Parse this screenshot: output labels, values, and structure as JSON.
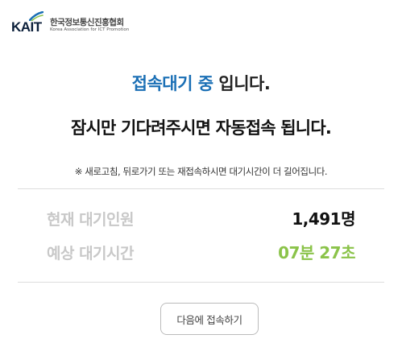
{
  "logo": {
    "mark": "KAIT",
    "name_ko": "한국정보통신진흥협회",
    "name_en": "Korea Association for ICT Promotion"
  },
  "status": {
    "title_highlight": "접속대기 중",
    "title_rest": " 입니다.",
    "message": "잠시만 기다려주시면 자동접속 됩니다.",
    "notice": "※ 새로고침, 뒤로가기 또는 재접속하시면 대기시간이 더 길어집니다."
  },
  "queue": {
    "waiting_label": "현재 대기인원",
    "waiting_value": "1,491명",
    "time_label": "예상 대기시간",
    "time_value": "07분 27초"
  },
  "actions": {
    "next_label": "다음에 접속하기"
  },
  "colors": {
    "highlight": "#1a6fb5",
    "time_value": "#8bc34a",
    "label_gray": "#c8c8c8"
  }
}
